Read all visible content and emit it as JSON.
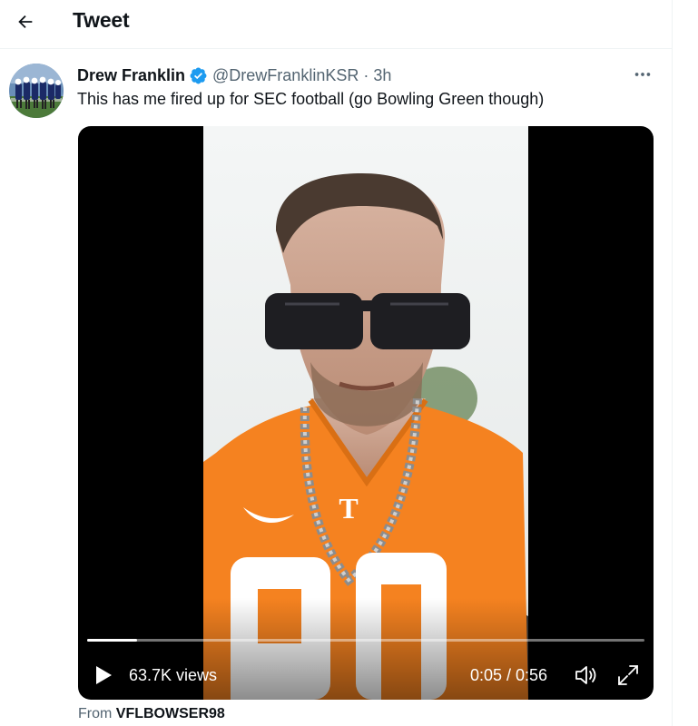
{
  "header": {
    "title": "Tweet",
    "back_icon": "arrow-left-icon"
  },
  "tweet": {
    "author_name": "Drew Franklin",
    "verified_icon": "verified-badge-icon",
    "handle": "@DrewFranklinKSR",
    "separator": "·",
    "time": "3h",
    "more_icon": "more-options-icon",
    "text": "This has me fired up for SEC football (go Bowling Green though)"
  },
  "video": {
    "progress": 0.089,
    "views": "63.7K views",
    "time_readout": "0:05 / 0:56",
    "play_icon": "play-icon",
    "volume_icon": "volume-icon",
    "fullscreen_icon": "fullscreen-icon"
  },
  "source": {
    "prefix": "From",
    "name": "VFLBOWSER98"
  },
  "colors": {
    "verified_blue": "#1d9bf0",
    "text_primary": "#0f1419",
    "text_secondary": "#536471",
    "jersey_orange": "#f58220",
    "divider": "#eff3f4"
  }
}
